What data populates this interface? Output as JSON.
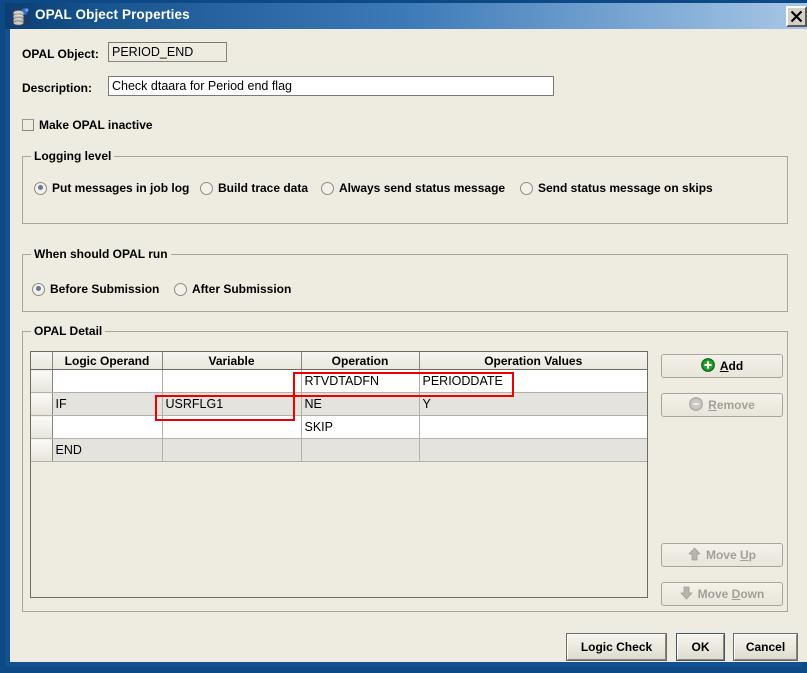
{
  "window": {
    "title": "OPAL Object Properties",
    "icon": "opal-object-icon",
    "close_label": "✕",
    "titlebar_gradient_start": "#0a3d74",
    "titlebar_gradient_end": "#a9c8e6",
    "border_color": "#0d4a85",
    "background": "#eeece1"
  },
  "fields": {
    "opal_object": {
      "label": "OPAL Object:",
      "value": "PERIOD_END",
      "placeholder": "",
      "readonly": true
    },
    "description": {
      "label": "Description:",
      "value": "Check dtaara for Period end flag",
      "placeholder": "",
      "readonly": false
    }
  },
  "inactive_checkbox": {
    "label": "Make OPAL inactive",
    "checked": false
  },
  "logging_level": {
    "title": "Logging level",
    "options": [
      {
        "label": "Put messages in job log",
        "selected": true
      },
      {
        "label": "Build trace data",
        "selected": false
      },
      {
        "label": "Always send status message",
        "selected": false
      },
      {
        "label": "Send status message on skips",
        "selected": false
      }
    ]
  },
  "when_run": {
    "title": "When should OPAL run",
    "options": [
      {
        "label": "Before Submission",
        "selected": true
      },
      {
        "label": "After Submission",
        "selected": false
      }
    ]
  },
  "opal_detail": {
    "title": "OPAL Detail",
    "columns": [
      "",
      "Logic Operand",
      "Variable",
      "Operation",
      "Operation Values"
    ],
    "rows": [
      {
        "handle": "",
        "logic_operand": "",
        "variable": "",
        "operation": "RTVDTADFN",
        "operation_values": "PERIODDATE",
        "shade": "white"
      },
      {
        "handle": "",
        "logic_operand": "IF",
        "variable": "USRFLG1",
        "operation": "NE",
        "operation_values": "Y",
        "shade": "gray"
      },
      {
        "handle": "",
        "logic_operand": "",
        "variable": "",
        "operation": "SKIP",
        "operation_values": "",
        "shade": "white"
      },
      {
        "handle": "",
        "logic_operand": "END",
        "variable": "",
        "operation": "",
        "operation_values": "",
        "shade": "gray"
      }
    ]
  },
  "annotations": {
    "color": "#ee0000",
    "boxes": [
      {
        "name": "operation-rtvdtadfn-highlight"
      },
      {
        "name": "variable-usrflg1-highlight"
      }
    ]
  },
  "side_buttons": [
    {
      "label": "Add",
      "mnemonic": "A",
      "icon": "plus-circle-icon",
      "enabled": true
    },
    {
      "label": "Remove",
      "mnemonic": "R",
      "icon": "minus-circle-icon",
      "enabled": false
    },
    {
      "label": "Move Up",
      "mnemonic": "U",
      "icon": "arrow-up-icon",
      "enabled": false
    },
    {
      "label": "Move Down",
      "mnemonic": "D",
      "icon": "arrow-down-icon",
      "enabled": false
    }
  ],
  "footer_buttons": [
    {
      "label": "Logic Check",
      "default": false
    },
    {
      "label": "OK",
      "default": true
    },
    {
      "label": "Cancel",
      "default": false
    }
  ]
}
